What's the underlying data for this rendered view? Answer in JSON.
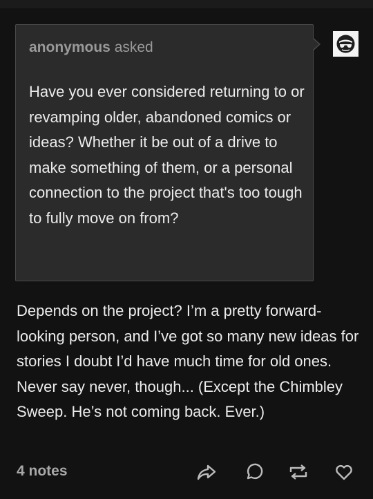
{
  "ask": {
    "asker": "anonymous",
    "verb": "asked",
    "question": "Have you ever considered returning to or revamping older, abandoned comics or ideas? Whether it be out of a drive to make something of them, or a personal connection to the project that's too tough to fully move on from?"
  },
  "answer": {
    "text": "Depends on the project? I’m a pretty forward-looking person, and I’ve got so many new ideas for stories I doubt I’d have much time for old ones. Never say never, though... (Except the Chimbley Sweep. He’s not coming back. Ever.)"
  },
  "footer": {
    "notes": "4 notes",
    "actions": [
      {
        "icon": "share-icon"
      },
      {
        "icon": "reply-icon"
      },
      {
        "icon": "reblog-icon"
      },
      {
        "icon": "like-icon"
      }
    ]
  },
  "colors": {
    "background": "#121212",
    "ask_box": "#2b2b2b",
    "muted_text": "#9a9a9a",
    "text": "#ececec"
  }
}
